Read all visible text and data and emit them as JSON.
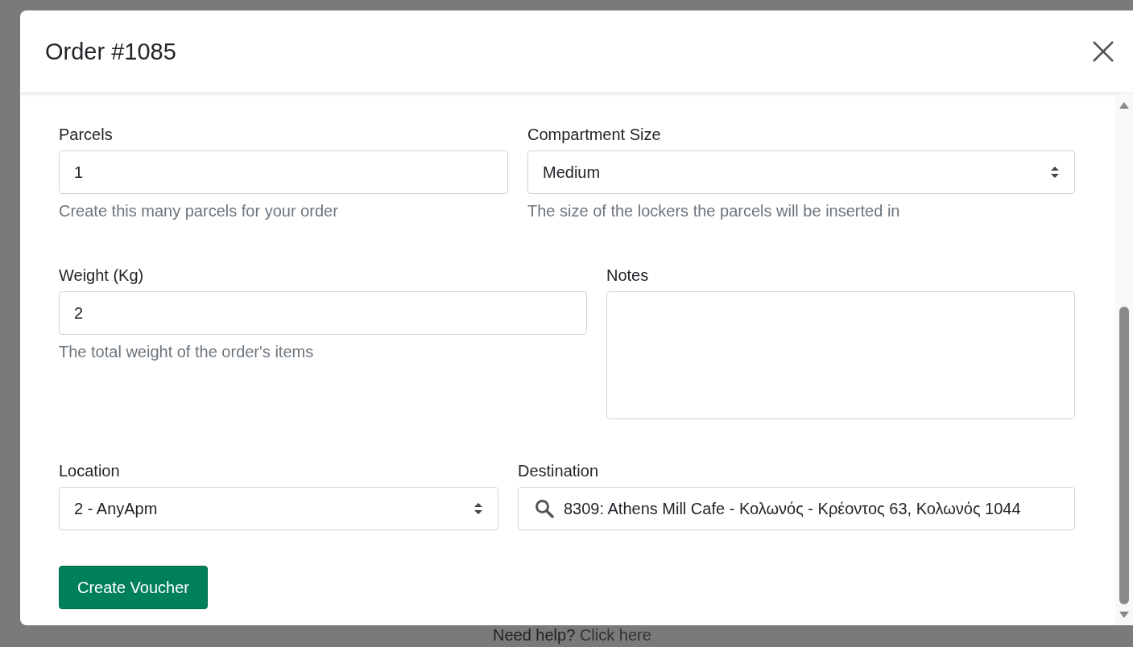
{
  "modal": {
    "title": "Order #1085"
  },
  "rows": [
    [
      {
        "kind": "input",
        "label": "Parcels",
        "value": "1",
        "help": "Create this many parcels for your order"
      },
      {
        "kind": "select",
        "label": "Compartment Size",
        "value": "Medium",
        "help": "The size of the lockers the parcels will be inserted in"
      }
    ],
    [
      {
        "kind": "input",
        "label": "Weight (Kg)",
        "value": "2",
        "help": "The total weight of the order's items"
      },
      {
        "kind": "textarea",
        "label": "Notes"
      }
    ],
    [
      {
        "kind": "select",
        "label": "Location",
        "value": "2 - AnyApm"
      },
      {
        "kind": "search",
        "label": "Destination",
        "value": "8309: Athens Mill Cafe - Κολωνός - Κρέοντος 63, Κολωνός 1044"
      }
    ]
  ],
  "submit": "Create Voucher",
  "footer": {
    "text": "Need help?",
    "link": "Click here"
  }
}
